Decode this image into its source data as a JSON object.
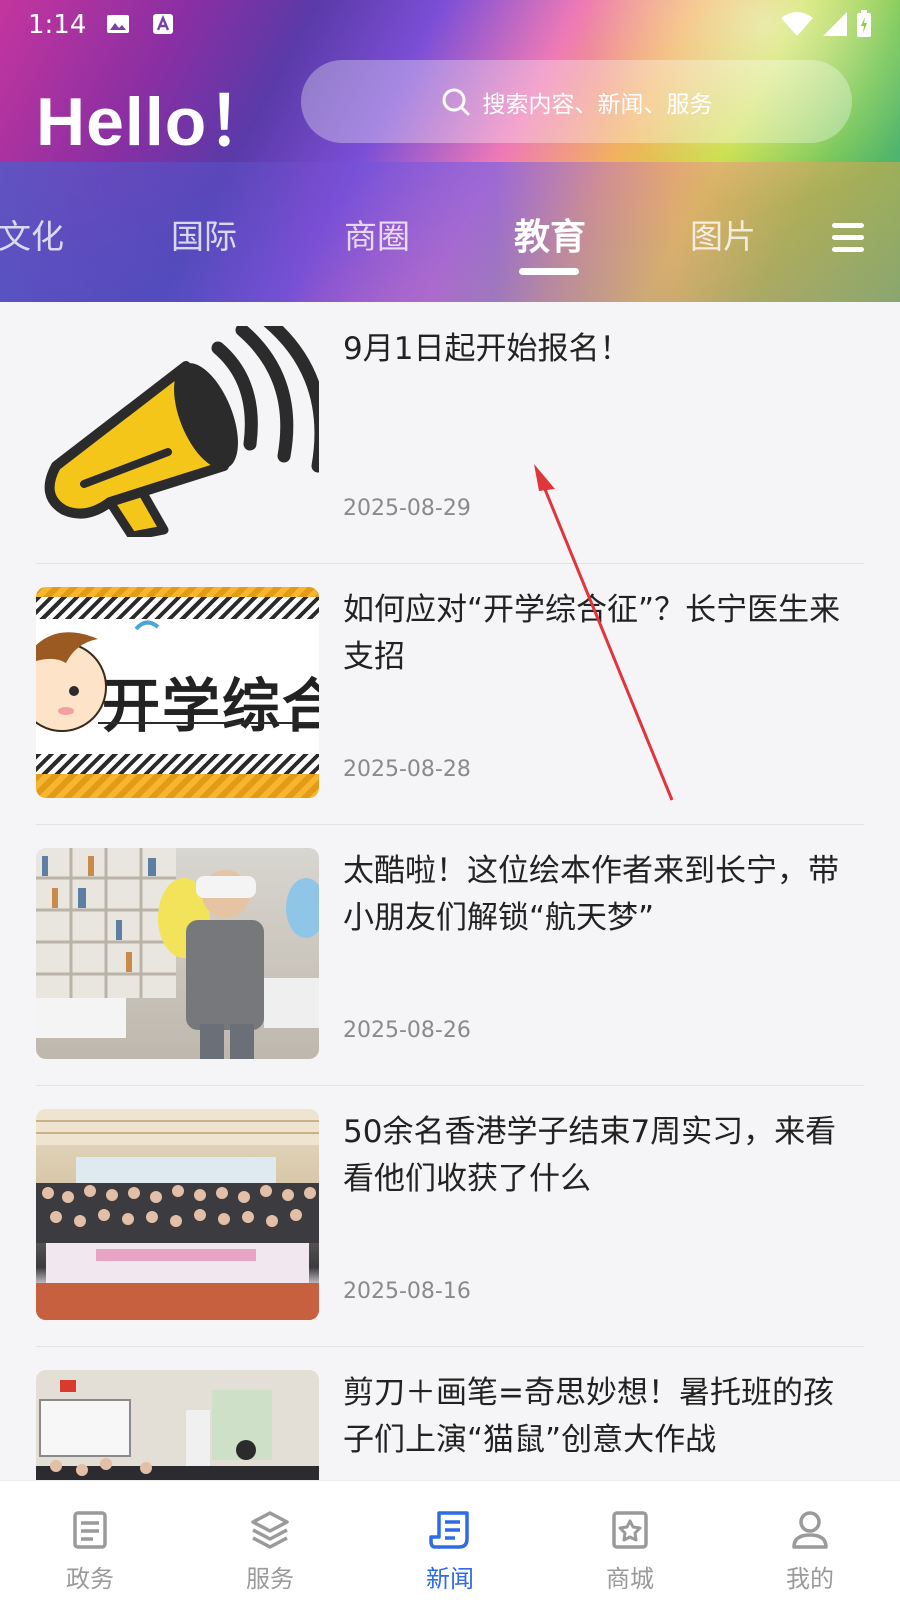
{
  "status_bar": {
    "time": "1:14"
  },
  "header": {
    "greeting": "Hello！",
    "search_placeholder": "搜索内容、新闻、服务"
  },
  "tabs": [
    {
      "label": "文化",
      "active": false
    },
    {
      "label": "国际",
      "active": false
    },
    {
      "label": "商圈",
      "active": false
    },
    {
      "label": "教育",
      "active": true
    },
    {
      "label": "图片",
      "active": false
    }
  ],
  "news": [
    {
      "title": "9月1日起开始报名！",
      "date": "2025-08-29"
    },
    {
      "title": "如何应对“开学综合征”？长宁医生来支招",
      "date": "2025-08-28",
      "thumb_text": "开学综合"
    },
    {
      "title": "太酷啦！这位绘本作者来到长宁，带小朋友们解锁“航天梦”",
      "date": "2025-08-26"
    },
    {
      "title": "50余名香港学子结束7周实习，来看看他们收获了什么",
      "date": "2025-08-16"
    },
    {
      "title": "剪刀＋画笔=奇思妙想！暑托班的孩子们上演“猫鼠”创意大作战",
      "date": ""
    }
  ],
  "bottom_nav": [
    {
      "label": "政务",
      "icon": "government-icon",
      "active": false
    },
    {
      "label": "服务",
      "icon": "layers-icon",
      "active": false
    },
    {
      "label": "新闻",
      "icon": "news-icon",
      "active": true
    },
    {
      "label": "商城",
      "icon": "shop-icon",
      "active": false
    },
    {
      "label": "我的",
      "icon": "user-icon",
      "active": false
    }
  ],
  "colors": {
    "accent": "#2f6be6",
    "annotation_arrow": "#e0353a"
  }
}
